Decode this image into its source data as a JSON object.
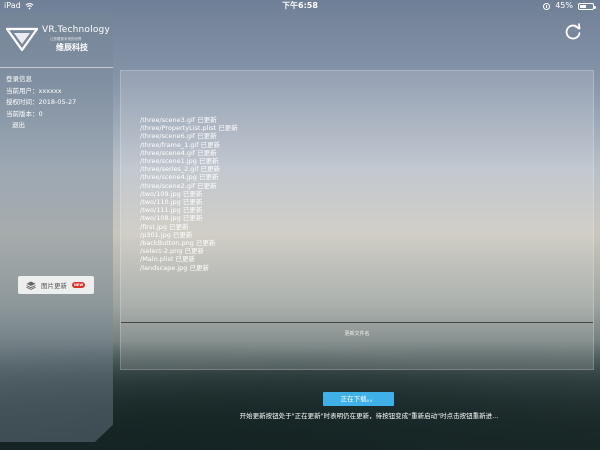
{
  "status_bar": {
    "carrier": "iPad",
    "time": "下午6:58",
    "battery": "45%",
    "battery_level": 0.45
  },
  "sidebar": {
    "logo": {
      "title": "VR.Technology",
      "subtitle": "让您看到未来的世界",
      "cn_name": "维辰科技"
    },
    "section_title": "登录信息",
    "current_user": "当前用户：xxxxxx",
    "auth_time": "授权时间：2018-05-27",
    "version": "当前版本：0",
    "logout": "退出",
    "image_update": {
      "label": "图片更新",
      "badge": "NEW"
    }
  },
  "panel": {
    "files": [
      "/three/scene3.gif 已更新",
      "/three/PropertyList.plist 已更新",
      "/three/scene6.gif 已更新",
      "/three/frame_1.gif 已更新",
      "/three/scene4.gif 已更新",
      "/three/scene1.jpg 已更新",
      "/three/series_2.gif 已更新",
      "/three/scene4.jpg 已更新",
      "/three/scene2.gif 已更新",
      "/two/109.jpg 已更新",
      "/two/110.jpg 已更新",
      "/two/111.jpg 已更新",
      "/two/108.jpg 已更新",
      "/first.jpg 已更新",
      "/p301.jpg 已更新",
      "/backButton.png 已更新",
      "/select-2.png 已更新",
      "/Main.plist 已更新",
      "/landscape.jpg 已更新"
    ],
    "footer": "更新文件名"
  },
  "download_button": "正在下载。。",
  "instruction": "开始更新按钮处于\"正在更新\"时表明仍在更新，待按钮变成\"重新启动\"时点击按钮重新进..."
}
